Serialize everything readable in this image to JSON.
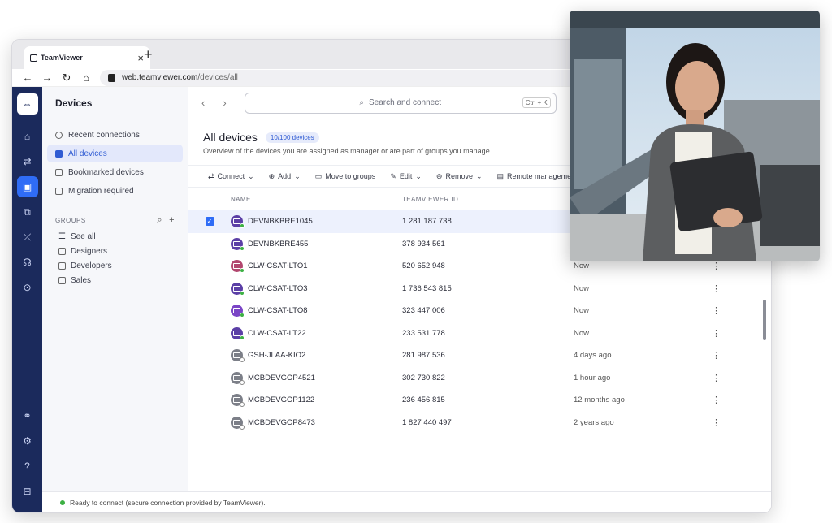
{
  "browser": {
    "tab_title": "TeamViewer",
    "tab_close": "×",
    "new_tab": "+",
    "url_host": "web.teamviewer.com",
    "url_path": "/devices/all"
  },
  "left_panel": {
    "title": "Devices",
    "items": [
      {
        "label": "Recent connections",
        "icon": "clock-icon"
      },
      {
        "label": "All devices",
        "icon": "devices-icon"
      },
      {
        "label": "Bookmarked devices",
        "icon": "bookmark-icon"
      },
      {
        "label": "Migration required",
        "icon": "migration-icon"
      }
    ],
    "groups_label": "GROUPS",
    "groups": [
      {
        "label": "See all",
        "icon": "list-icon"
      },
      {
        "label": "Designers",
        "icon": "group-icon"
      },
      {
        "label": "Developers",
        "icon": "group-icon"
      },
      {
        "label": "Sales",
        "icon": "group-icon"
      }
    ]
  },
  "search": {
    "placeholder": "Search and connect",
    "shortcut": "Ctrl + K"
  },
  "main": {
    "title": "All devices",
    "count_badge": "10/100 devices",
    "subtitle": "Overview of the devices you are assigned as manager or are part of groups you manage.",
    "toolbar": {
      "connect": "Connect",
      "add": "Add",
      "move": "Move to groups",
      "edit": "Edit",
      "remove": "Remove",
      "remote": "Remote managemen"
    },
    "columns": {
      "name": "NAME",
      "id": "TEAMVIEWER ID"
    },
    "rows": [
      {
        "name": "DEVNBKBRE1045",
        "id": "1 281 187 738",
        "last": "",
        "color": "#5b3fa6",
        "online": true
      },
      {
        "name": "DEVNBKBRE455",
        "id": "378 934 561",
        "last": "",
        "color": "#5b3fa6",
        "online": true
      },
      {
        "name": "CLW-CSAT-LTO1",
        "id": "520 652 948",
        "last": "Now",
        "color": "#b1466e",
        "online": true
      },
      {
        "name": "CLW-CSAT-LTO3",
        "id": "1 736 543 815",
        "last": "Now",
        "color": "#5b3fa6",
        "online": true
      },
      {
        "name": "CLW-CSAT-LTO8",
        "id": "323 447 006",
        "last": "Now",
        "color": "#7a45c6",
        "online": true
      },
      {
        "name": "CLW-CSAT-LT22",
        "id": "233 531 778",
        "last": "Now",
        "color": "#5b3fa6",
        "online": true
      },
      {
        "name": "GSH-JLAA-KIO2",
        "id": "281 987 536",
        "last": "4 days ago",
        "color": "#7c7f88",
        "online": false
      },
      {
        "name": "MCBDEVGOP4521",
        "id": "302 730 822",
        "last": "1 hour ago",
        "color": "#7c7f88",
        "online": false
      },
      {
        "name": "MCBDEVGOP1122",
        "id": "236 456 815",
        "last": "12 months ago",
        "color": "#7c7f88",
        "online": false
      },
      {
        "name": "MCBDEVGOP8473",
        "id": "1 827 440 497",
        "last": "2 years ago",
        "color": "#7c7f88",
        "online": false
      }
    ],
    "more": "⋮"
  },
  "status": {
    "text": "Ready to connect (secure connection provided by TeamViewer)."
  }
}
